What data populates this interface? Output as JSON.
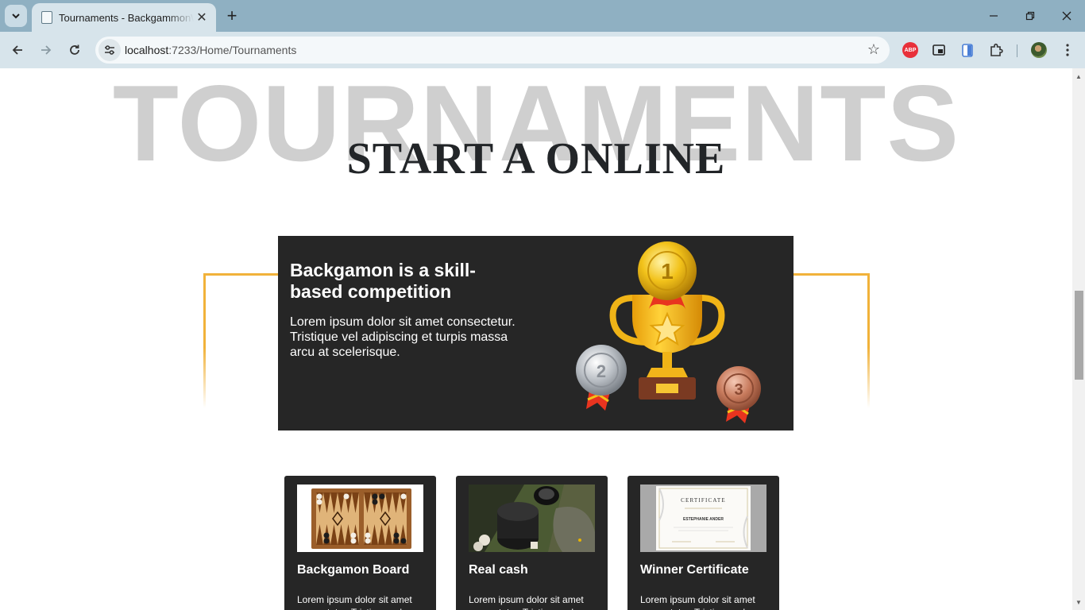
{
  "browser": {
    "tab_title": "Tournaments - BackgammonW",
    "url_host": "localhost",
    "url_path": ":7233/Home/Tournaments",
    "abp_label": "ABP"
  },
  "page": {
    "background_word": "TOURNAMENTS",
    "headline": "START A ONLINE",
    "hero": {
      "title": "Backgamon is a skill-based competition",
      "text": "Lorem ipsum dolor sit amet consectetur. Tristique vel adipiscing et turpis massa arcu at scelerisque."
    },
    "cards": [
      {
        "title": "Backgamon Board",
        "text": "Lorem ipsum dolor sit amet consectetur. Tristique vel"
      },
      {
        "title": "Real cash",
        "text": "Lorem ipsum dolor sit amet consectetur. Tristique vel"
      },
      {
        "title": "Winner Certificate",
        "text": "Lorem ipsum dolor sit amet consectetur. Tristique vel"
      }
    ],
    "certificate": {
      "heading": "CERTIFICATE",
      "name": "ESTEPHANIE ANDER"
    },
    "trophy_numbers": {
      "gold": "1",
      "silver": "2",
      "bronze": "3"
    }
  },
  "colors": {
    "accent_frame": "#f1b23a",
    "hero_bg": "#262626",
    "bg_word": "#cfcfcf",
    "headline": "#222528"
  }
}
